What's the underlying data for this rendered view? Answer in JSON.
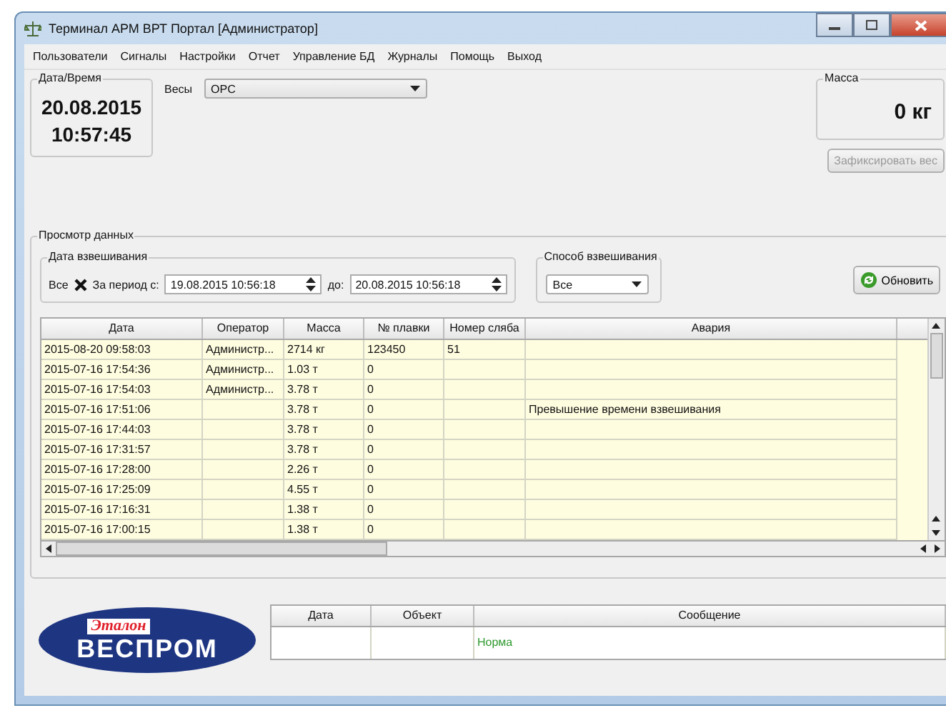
{
  "window": {
    "title": "Терминал АРМ ВРТ Портал [Администратор]"
  },
  "menu": [
    "Пользователи",
    "Сигналы",
    "Настройки",
    "Отчет",
    "Управление БД",
    "Журналы",
    "Помощь",
    "Выход"
  ],
  "datetime": {
    "label": "Дата/Время",
    "date": "20.08.2015",
    "time": "10:57:45"
  },
  "scale": {
    "label": "Весы",
    "value": "OPC"
  },
  "mass": {
    "label": "Масса",
    "value": "0 кг",
    "fix_button": "Зафиксировать вес",
    "fix_disabled": true
  },
  "data_view": {
    "label": "Просмотр данных",
    "date_group": {
      "label": "Дата взвешивания",
      "all_label": "Все",
      "all_checked": true,
      "period_label": "За период с:",
      "from": "19.08.2015 10:56:18",
      "to_label": "до:",
      "to": "20.08.2015 10:56:18"
    },
    "method_group": {
      "label": "Способ взвешивания",
      "value": "Все"
    },
    "refresh_button": "Обновить",
    "table": {
      "columns": [
        "Дата",
        "Оператор",
        "Масса",
        "№ плавки",
        "Номер сляба",
        "Авария"
      ],
      "rows": [
        [
          "2015-08-20 09:58:03",
          "Администр...",
          "2714 кг",
          "123450",
          "51",
          ""
        ],
        [
          "2015-07-16 17:54:36",
          "Администр...",
          "1.03 т",
          "0",
          "",
          ""
        ],
        [
          "2015-07-16 17:54:03",
          "Администр...",
          "3.78 т",
          "0",
          "",
          ""
        ],
        [
          "2015-07-16 17:51:06",
          "",
          "3.78 т",
          "0",
          "",
          "Превышение времени взвешивания"
        ],
        [
          "2015-07-16 17:44:03",
          "",
          "3.78 т",
          "0",
          "",
          ""
        ],
        [
          "2015-07-16 17:31:57",
          "",
          "3.78 т",
          "0",
          "",
          ""
        ],
        [
          "2015-07-16 17:28:00",
          "",
          "2.26 т",
          "0",
          "",
          ""
        ],
        [
          "2015-07-16 17:25:09",
          "",
          "4.55 т",
          "0",
          "",
          ""
        ],
        [
          "2015-07-16 17:16:31",
          "",
          "1.38 т",
          "0",
          "",
          ""
        ],
        [
          "2015-07-16 17:00:15",
          "",
          "1.38 т",
          "0",
          "",
          ""
        ]
      ]
    }
  },
  "logo": {
    "top": "Эталон",
    "bottom": "ВЕСПРОМ"
  },
  "messages": {
    "columns": [
      "Дата",
      "Объект",
      "Сообщение"
    ],
    "rows": [
      {
        "cells": [
          "",
          "",
          "Норма"
        ],
        "color": "#2e9a2e"
      }
    ]
  }
}
